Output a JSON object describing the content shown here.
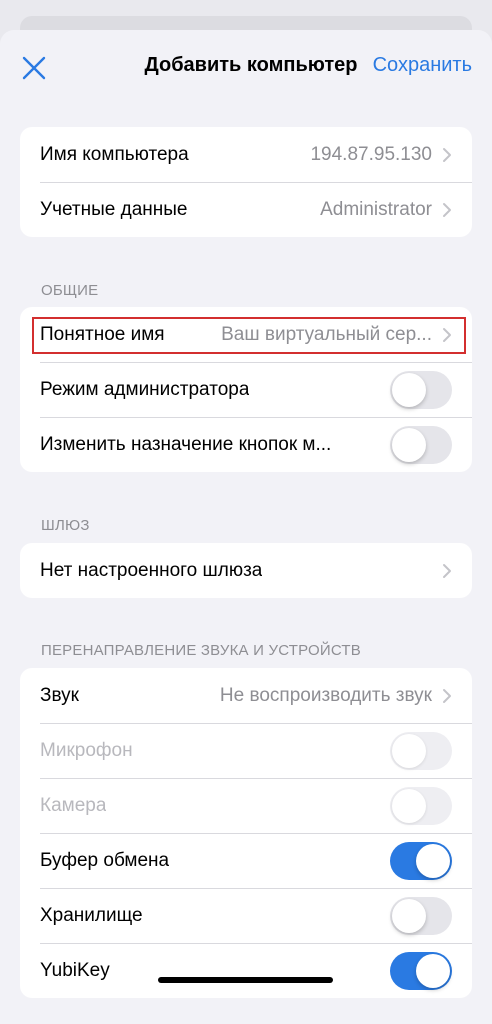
{
  "nav": {
    "title": "Добавить компьютер",
    "save_label": "Сохранить",
    "close_icon": "close-icon",
    "accent": "#2a7ae2"
  },
  "main": {
    "rows": [
      {
        "label": "Имя компьютера",
        "value": "194.87.95.130"
      },
      {
        "label": "Учетные данные",
        "value": "Administrator"
      }
    ]
  },
  "general": {
    "header": "ОБЩИЕ",
    "friendly_name": {
      "label": "Понятное имя",
      "value": "Ваш виртуальный сер..."
    },
    "admin_mode": {
      "label": "Режим администратора",
      "on": false
    },
    "swap_buttons": {
      "label": "Изменить назначение кнопок м...",
      "on": false
    }
  },
  "gateway": {
    "header": "ШЛЮЗ",
    "row": {
      "label": "Нет настроенного шлюза"
    }
  },
  "redirection": {
    "header": "ПЕРЕНАПРАВЛЕНИЕ ЗВУКА И УСТРОЙСТВ",
    "sound": {
      "label": "Звук",
      "value": "Не воспроизводить звук"
    },
    "microphone": {
      "label": "Микрофон",
      "on": false,
      "disabled": true
    },
    "camera": {
      "label": "Камера",
      "on": false,
      "disabled": true
    },
    "clipboard": {
      "label": "Буфер обмена",
      "on": true
    },
    "storage": {
      "label": "Хранилище",
      "on": false
    },
    "yubikey": {
      "label": "YubiKey",
      "on": true
    }
  }
}
